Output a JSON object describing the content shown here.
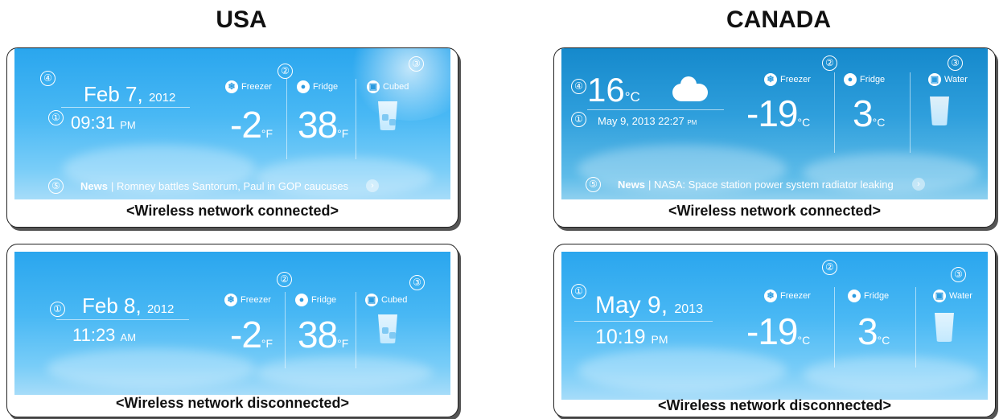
{
  "regions": {
    "usa": "USA",
    "canada": "CANADA"
  },
  "markers": [
    "①",
    "②",
    "③",
    "④",
    "⑤"
  ],
  "usa_connected": {
    "date_main": "Feb 7,",
    "date_year": "2012",
    "time": "09:31",
    "ampm": "PM",
    "freezer_label": "Freezer",
    "fridge_label": "Fridge",
    "ice_label": "Cubed",
    "freezer_temp": "-2",
    "fridge_temp": "38",
    "unit": "°F",
    "news_label": "News",
    "news_text": "| Romney battles Santorum, Paul in GOP caucuses",
    "caption": "<Wireless network connected>"
  },
  "usa_disconnected": {
    "date_main": "Feb 8,",
    "date_year": "2012",
    "time": "11:23",
    "ampm": "AM",
    "freezer_label": "Freezer",
    "fridge_label": "Fridge",
    "ice_label": "Cubed",
    "freezer_temp": "-2",
    "fridge_temp": "38",
    "unit": "°F",
    "caption": "<Wireless network disconnected>"
  },
  "canada_connected": {
    "weather_temp": "16",
    "weather_unit": "°C",
    "datetime": "May 9, 2013 22:27",
    "ampm": "PM",
    "freezer_label": "Freezer",
    "fridge_label": "Fridge",
    "water_label": "Water",
    "freezer_temp": "-19",
    "fridge_temp": "3",
    "unit": "°C",
    "news_label": "News",
    "news_text": "| NASA: Space station power system radiator leaking",
    "caption": "<Wireless network connected>"
  },
  "canada_disconnected": {
    "date_main": "May 9,",
    "date_year": "2013",
    "time": "10:19",
    "ampm": "PM",
    "freezer_label": "Freezer",
    "fridge_label": "Fridge",
    "water_label": "Water",
    "freezer_temp": "-19",
    "fridge_temp": "3",
    "unit": "°C",
    "caption": "<Wireless network disconnected>"
  },
  "icons": {
    "freezer": "snowflake-icon",
    "fridge": "water-drop-icon",
    "ice": "ice-cup-icon",
    "water": "water-cup-icon",
    "arrow": "chevron-right-icon",
    "weather": "rain-cloud-icon"
  }
}
